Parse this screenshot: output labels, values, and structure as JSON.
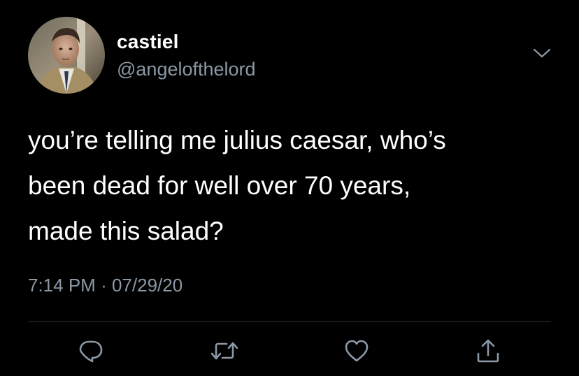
{
  "user": {
    "display_name": "castiel",
    "handle": "@angelofthelord"
  },
  "tweet": {
    "text": "you’re telling me julius caesar, who’s\nbeen dead for well over 70 years,\nmade this salad?",
    "time": "7:14 PM",
    "separator": "·",
    "date": "07/29/20"
  },
  "actions": {
    "reply_icon": "reply-icon",
    "retweet_icon": "retweet-icon",
    "like_icon": "heart-icon",
    "share_icon": "share-icon",
    "menu_icon": "chevron-down-icon"
  },
  "colors": {
    "background": "#000000",
    "text": "#ffffff",
    "secondary_text": "#8b98a5",
    "divider": "#2f3336"
  }
}
